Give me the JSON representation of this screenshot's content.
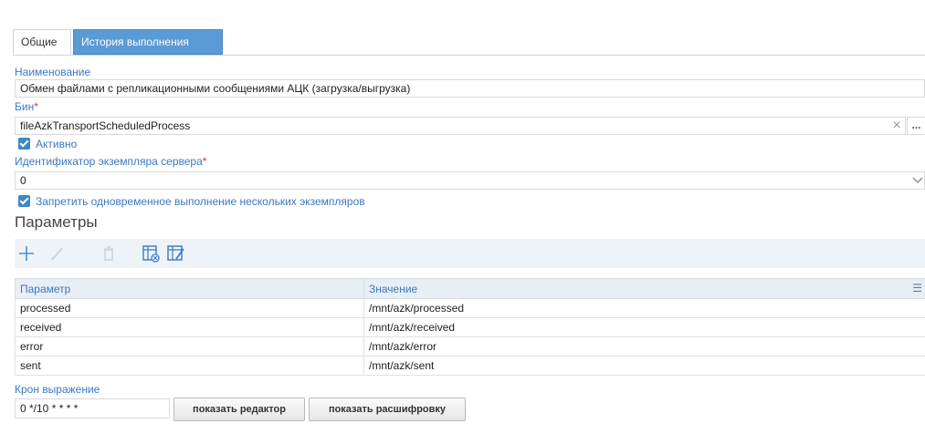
{
  "tabs": [
    {
      "label": "Общие",
      "active": true
    },
    {
      "label": "История выполнения",
      "active": false
    }
  ],
  "form": {
    "name_label": "Наименование",
    "name_value": "Обмен файлами с репликационными сообщениями АЦК (загрузка/выгрузка)",
    "bean_label": "Бин",
    "bean_value": "fileAzkTransportScheduledProcess",
    "clear_symbol": "×",
    "lookup_symbol": "...",
    "active_label": "Активно",
    "active_checked": true,
    "server_id_label": "Идентификатор экземпляра сервера",
    "server_id_value": "0",
    "forbid_concurrent_label": "Запретить одновременное выполнение нескольких экземпляров",
    "forbid_concurrent_checked": true,
    "required_mark": "*"
  },
  "params": {
    "title": "Параметры",
    "toolbar_icons": [
      "plus-icon",
      "pencil-icon",
      "trash-icon",
      "table-delete-icon",
      "table-edit-icon"
    ],
    "columns": [
      "Параметр",
      "Значение"
    ],
    "column_menu_symbol": "☰",
    "rows": [
      {
        "param": "processed",
        "value": "/mnt/azk/processed"
      },
      {
        "param": "received",
        "value": "/mnt/azk/received"
      },
      {
        "param": "error",
        "value": "/mnt/azk/error"
      },
      {
        "param": "sent",
        "value": "/mnt/azk/sent"
      }
    ]
  },
  "cron": {
    "label": "Крон выражение",
    "value": "0 */10 * * * *",
    "show_editor_label": "показать редактор",
    "show_decoding_label": "показать расшифровку"
  },
  "colors": {
    "accent": "#3a78c2",
    "tab_active_bg": "#5b9bd5",
    "checkbox": "#3d88c9",
    "required": "#e03030",
    "toolbar_bg": "#eef3f8",
    "header_bg": "#e8eef4"
  }
}
